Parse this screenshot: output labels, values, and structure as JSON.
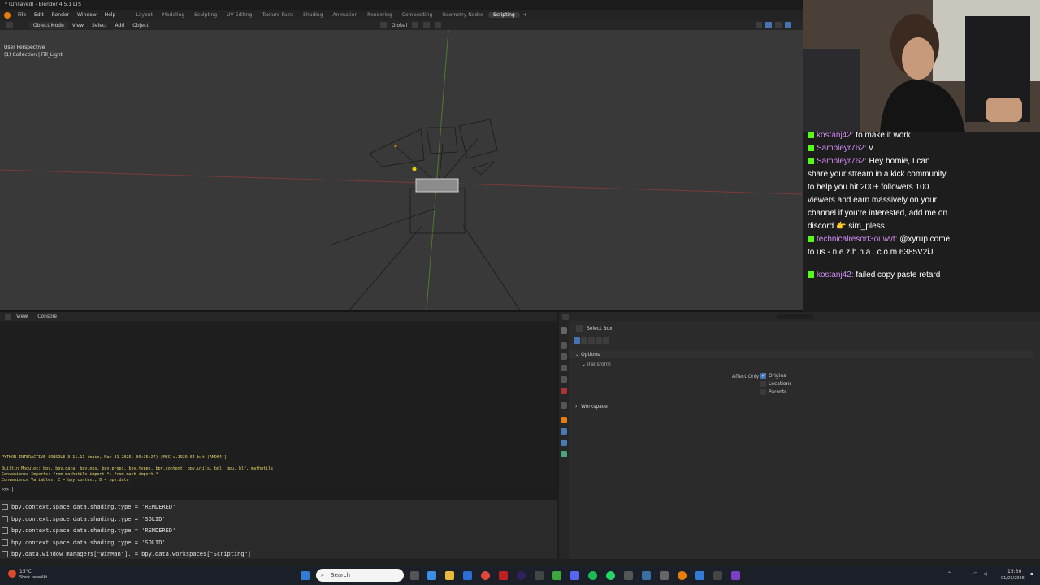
{
  "window": {
    "title": "* (Unsaved) - Blender 4.5.1 LTS"
  },
  "menubar": {
    "menus": [
      "File",
      "Edit",
      "Render",
      "Window",
      "Help"
    ],
    "workspaces": [
      "Layout",
      "Modeling",
      "Sculpting",
      "UV Editing",
      "Texture Paint",
      "Shading",
      "Animation",
      "Rendering",
      "Compositing",
      "Geometry Nodes",
      "Scripting"
    ],
    "active_workspace": "Scripting",
    "add_tab": "+"
  },
  "viewport_header": {
    "mode": "Object Mode",
    "menus": [
      "View",
      "Select",
      "Add",
      "Object"
    ],
    "transform_orientation": "Global"
  },
  "viewport": {
    "perspective": "User Perspective",
    "collection": "(1) Collection | Fill_Light"
  },
  "chat": {
    "messages": [
      {
        "user": "kostanj42:",
        "text": "to make it work"
      },
      {
        "user": "Sampleyr762:",
        "text": "v"
      },
      {
        "user": "Sampleyr762:",
        "text": "Hey homie, I can share your stream in a kick community to help you hit 200+ followers 100 viewers and earn massively on your channel if you're interested, add me on discord 👉 sim_pless"
      },
      {
        "user": "technicalresort3ouwvt:",
        "text": "@xyrup come to us - n.e.z.h.n.a . c.o.m 6385V2iJ"
      },
      {
        "user": "kostanj42:",
        "text": "failed copy paste retard"
      }
    ]
  },
  "console": {
    "header_items": [
      "View",
      "Console"
    ],
    "banner": "PYTHON INTERACTIVE CONSOLE 3.11.11 (main, May 31 2025, 09:35:27) [MSC v.1929 64 bit (AMD64)]",
    "builtin": "Builtin Modules:       bpy, bpy.data, bpy.ops, bpy.props, bpy.types, bpy.context, bpy.utils, bgl, gpu, blf, mathutils",
    "imports": "Convenience Imports:   from mathutils import *; from math import *",
    "variables": "Convenience Variables: C = bpy.context, D = bpy.data",
    "prompt": ">>> |",
    "history": [
      "bpy.context.space data.shading.type = 'RENDERED'",
      "bpy.context.space data.shading.type = 'SOLID'",
      "bpy.context.space data.shading.type = 'RENDERED'",
      "bpy.context.space data.shading.type = 'SOLID'",
      "bpy.data.window managers[\"WinMan\"]. = bpy.data.workspaces[\"Scripting\"]"
    ]
  },
  "properties": {
    "tool": "Select Box",
    "sections": {
      "options": "Options",
      "transform": "Transform",
      "workspace": "Workspace"
    },
    "affect_only": "Affect Only",
    "checks": [
      {
        "label": "Origins",
        "checked": true
      },
      {
        "label": "Locations",
        "checked": false
      },
      {
        "label": "Parents",
        "checked": false
      }
    ]
  },
  "taskbar": {
    "weather_temp": "15°C",
    "weather_desc": "Stark bewölkt",
    "search_placeholder": "Search",
    "time": "15:30",
    "date": "01/03/2026"
  },
  "colors": {
    "accent": "#4772b3",
    "kick_green": "#53fc18",
    "console_yellow": "#e6d46a"
  }
}
